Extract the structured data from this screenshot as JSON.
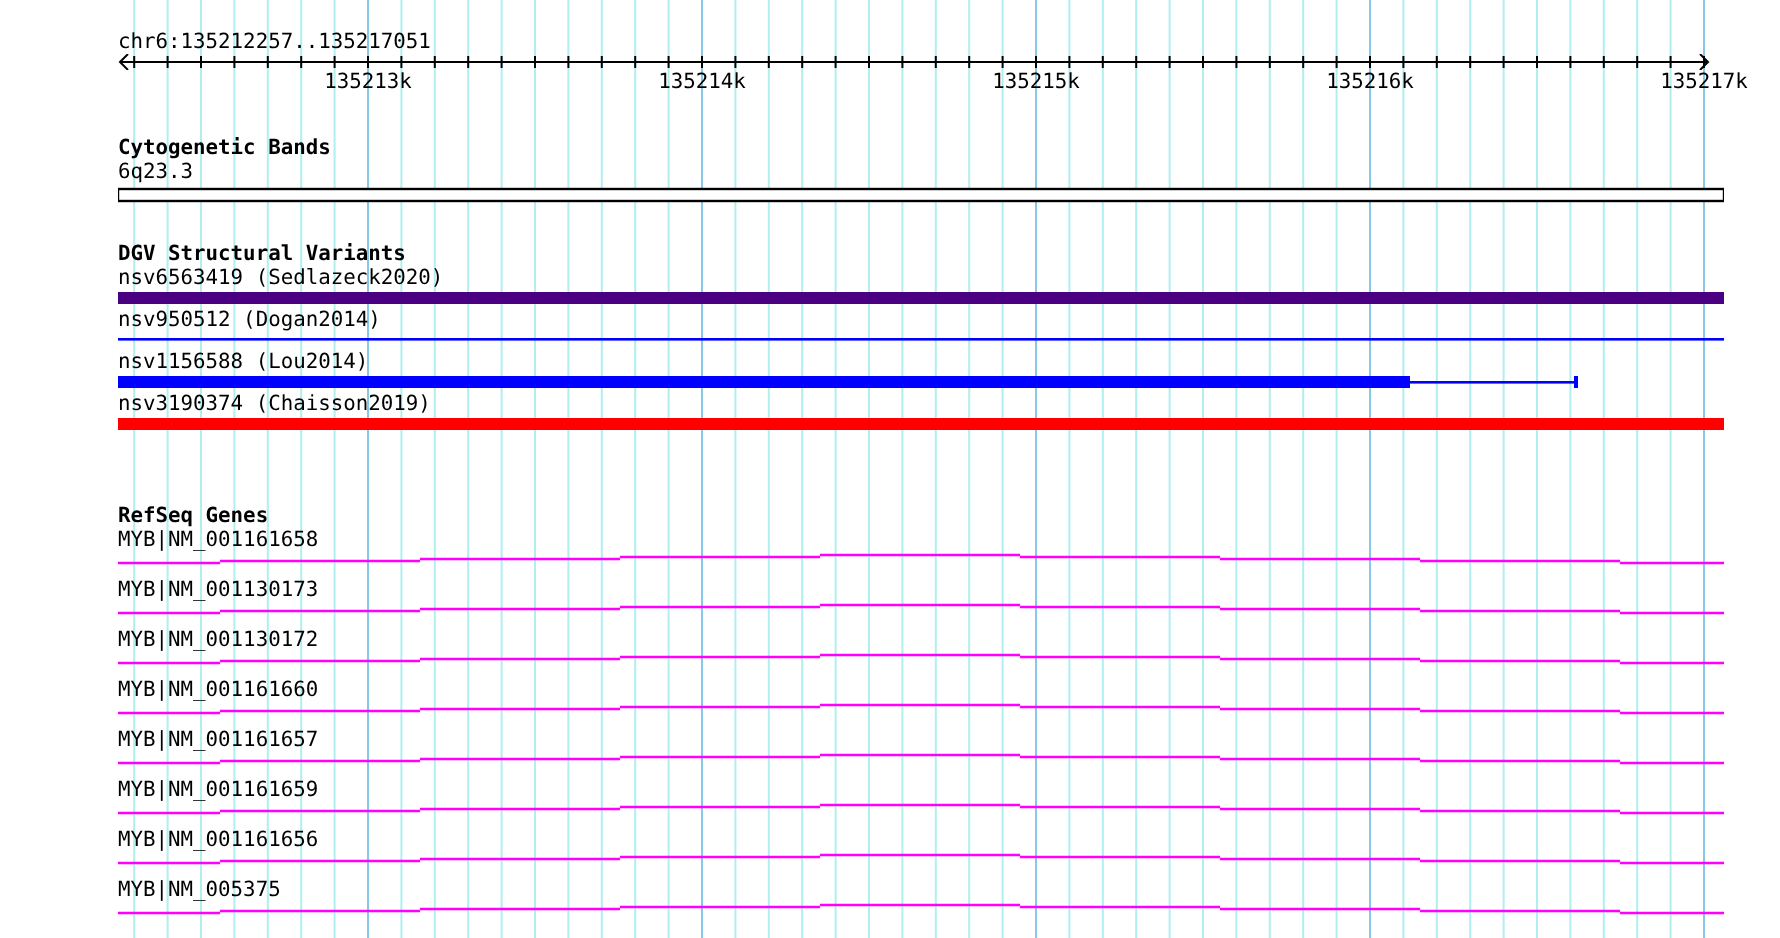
{
  "ruler": {
    "location": "chr6:135212257..135217051",
    "ticks": [
      "135213k",
      "135214k",
      "135215k",
      "135216k",
      "135217k"
    ]
  },
  "tracks": [
    {
      "kind": "cytoband",
      "title": "Cytogenetic Bands",
      "features": [
        {
          "label": "6q23.3"
        }
      ]
    },
    {
      "kind": "variants",
      "title": "DGV Structural Variants",
      "features": [
        {
          "label": "nsv6563419 (Sedlazeck2020)",
          "color": "#4b0082",
          "kind": "thick"
        },
        {
          "label": "nsv950512 (Dogan2014)",
          "color": "#0000ff",
          "kind": "thin"
        },
        {
          "label": "nsv1156588 (Lou2014)",
          "color": "#0000ff",
          "kind": "partial"
        },
        {
          "label": "nsv3190374 (Chaisson2019)",
          "color": "#ff0000",
          "kind": "thick"
        }
      ]
    },
    {
      "kind": "genes",
      "title": "RefSeq Genes",
      "features": [
        {
          "label": "MYB|NM_001161658"
        },
        {
          "label": "MYB|NM_001130173"
        },
        {
          "label": "MYB|NM_001130172"
        },
        {
          "label": "MYB|NM_001161660"
        },
        {
          "label": "MYB|NM_001161657"
        },
        {
          "label": "MYB|NM_001161659"
        },
        {
          "label": "MYB|NM_001161656"
        },
        {
          "label": "MYB|NM_005375"
        }
      ]
    }
  ]
}
